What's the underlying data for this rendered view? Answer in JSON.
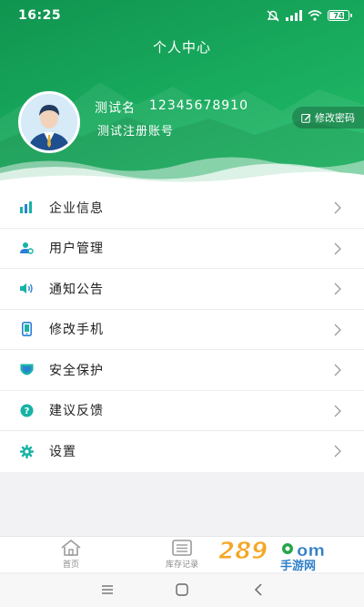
{
  "status_bar": {
    "time": "16:25",
    "battery": "74"
  },
  "header": {
    "title": "个人中心",
    "user_name": "测试名",
    "phone": "12345678910",
    "account_note": "测试注册账号",
    "change_password_label": "修改密码"
  },
  "menu": {
    "items": [
      {
        "label": "企业信息",
        "icon": "bar-chart-icon"
      },
      {
        "label": "用户管理",
        "icon": "user-manage-icon"
      },
      {
        "label": "通知公告",
        "icon": "speaker-icon"
      },
      {
        "label": "修改手机",
        "icon": "phone-icon"
      },
      {
        "label": "安全保护",
        "icon": "shield-icon"
      },
      {
        "label": "建议反馈",
        "icon": "question-icon"
      },
      {
        "label": "设置",
        "icon": "gear-icon"
      }
    ]
  },
  "tabbar": {
    "tabs": [
      {
        "label": "首页",
        "icon": "home-icon"
      },
      {
        "label": "库存记录",
        "icon": "inventory-icon"
      }
    ]
  },
  "watermark": {
    "text": "手游网"
  },
  "colors": {
    "brand_green": "#17a85c",
    "icon_teal": "#16b3a5",
    "icon_blue": "#2c7fd6"
  }
}
